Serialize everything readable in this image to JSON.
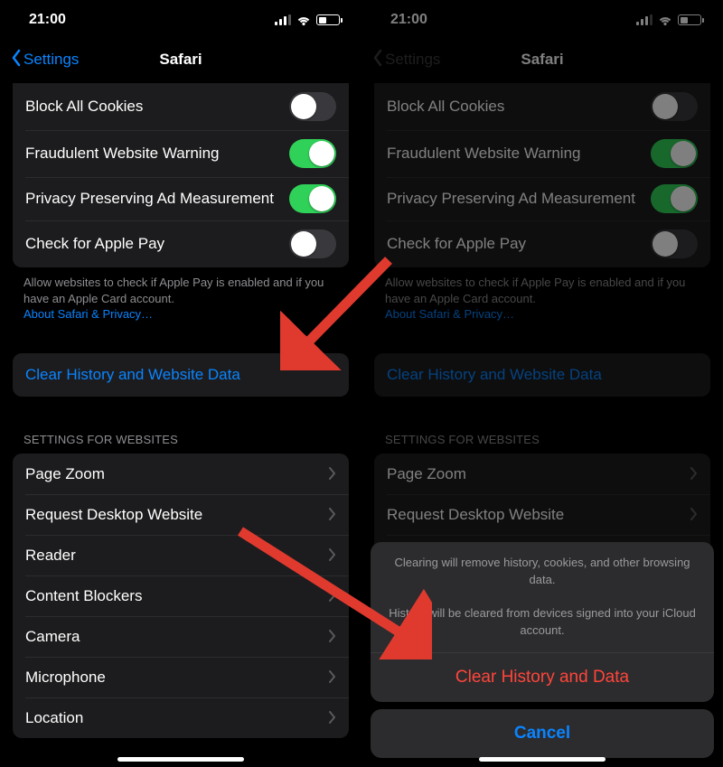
{
  "status": {
    "time": "21:00"
  },
  "nav": {
    "back": "Settings",
    "title": "Safari"
  },
  "privacy_rows": {
    "block_cookies": {
      "label": "Block All Cookies",
      "on": false
    },
    "fraud_warning": {
      "label": "Fraudulent Website Warning",
      "on": true
    },
    "ppam": {
      "label": "Privacy Preserving Ad Measurement",
      "on": true
    },
    "apple_pay": {
      "label": "Check for Apple Pay",
      "on": false
    }
  },
  "privacy_footer": {
    "text": "Allow websites to check if Apple Pay is enabled and if you have an Apple Card account.",
    "link": "About Safari & Privacy…"
  },
  "clear_button": "Clear History and Website Data",
  "websites_header": "SETTINGS FOR WEBSITES",
  "website_rows": [
    "Page Zoom",
    "Request Desktop Website",
    "Reader",
    "Content Blockers",
    "Camera",
    "Microphone",
    "Location"
  ],
  "sheet": {
    "msg1": "Clearing will remove history, cookies, and other browsing data.",
    "msg2": "History will be cleared from devices signed into your iCloud account.",
    "action": "Clear History and Data",
    "cancel": "Cancel"
  },
  "colors": {
    "accent_blue": "#0a84ff",
    "destructive_red": "#ff453a",
    "toggle_green": "#30d158",
    "arrow_red": "#e03a2f"
  }
}
